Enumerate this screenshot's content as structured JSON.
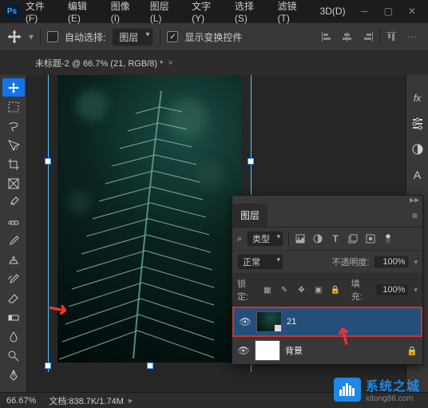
{
  "menu": [
    "文件(F)",
    "编辑(E)",
    "图像(I)",
    "图层(L)",
    "文字(Y)",
    "选择(S)",
    "滤镜(T)",
    "3D(D)"
  ],
  "options": {
    "auto_select": "自动选择:",
    "target": "图层",
    "show_controls": "显示变换控件"
  },
  "doc_tab": "未标题-2 @ 66.7% (21, RGB/8) *",
  "status": {
    "zoom": "66.67%",
    "doc": "文档:838.7K/1.74M"
  },
  "rail_icons": [
    "fx",
    "tune",
    "adjust",
    "glyph",
    "type",
    "para"
  ],
  "layers": {
    "title": "图层",
    "filter_kind": "类型",
    "blend": "正常",
    "opacity_label": "不透明度:",
    "opacity": "100%",
    "lock_label": "锁定:",
    "fill_label": "填充:",
    "fill": "100%",
    "rows": [
      {
        "name": "21",
        "selected": true,
        "smart": true
      },
      {
        "name": "背景",
        "locked": true
      }
    ]
  },
  "watermark": {
    "title": "系统之城",
    "url": "xitong86.com"
  }
}
